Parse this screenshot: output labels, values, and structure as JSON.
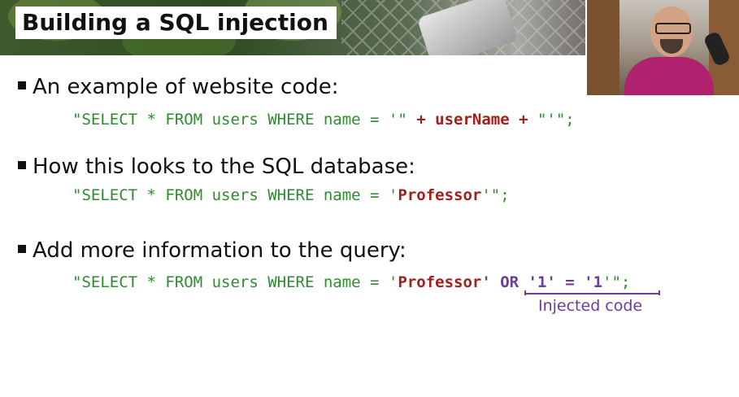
{
  "slide": {
    "title": "Building a SQL injection",
    "bullets": [
      {
        "text": "An example of website code:",
        "code": {
          "p1": "\"SELECT * FROM users WHERE name = '\"",
          "plus1": " + ",
          "var": "userName",
          "plus2": " + ",
          "p2": "\"'\";"
        }
      },
      {
        "text": "How this looks to the SQL database:",
        "code": {
          "p1": "\"SELECT * FROM users WHERE name = '",
          "val": "Professor",
          "p2": "'\";"
        }
      },
      {
        "text": "Add more information to the query:",
        "code": {
          "p1": "\"SELECT * FROM users WHERE name = '",
          "val": "Professor",
          "inj": "' OR '1' = '1",
          "p2": "'\";"
        }
      }
    ],
    "annotation": "Injected code"
  },
  "colors": {
    "code": "#2e8b2e",
    "highlight": "#a0201a",
    "injected": "#6a3d9a"
  }
}
